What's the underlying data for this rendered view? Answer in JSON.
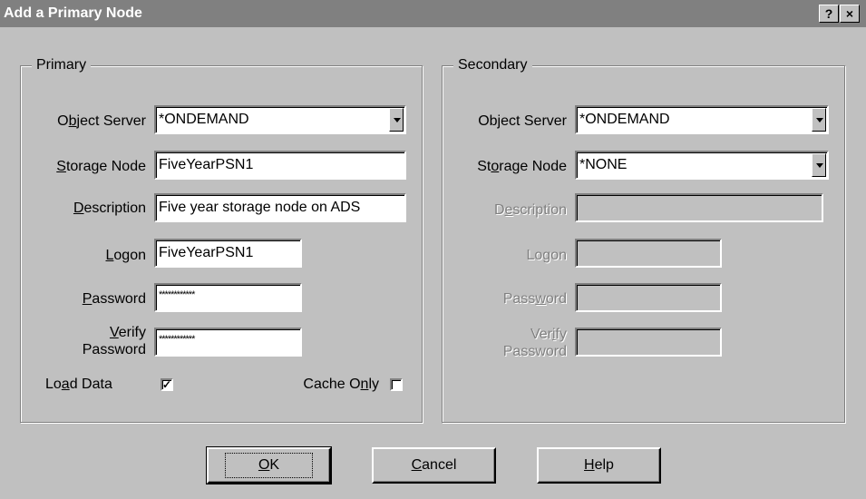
{
  "window": {
    "title": "Add a Primary Node",
    "help_btn": "?",
    "close_btn": "×"
  },
  "primary": {
    "legend": "Primary",
    "object_server": {
      "label_pre": "O",
      "label_ul": "b",
      "label_post": "ject Server",
      "value": "*ONDEMAND"
    },
    "storage_node": {
      "label_pre": "",
      "label_ul": "S",
      "label_post": "torage Node",
      "value": "FiveYearPSN1"
    },
    "description": {
      "label_pre": "",
      "label_ul": "D",
      "label_post": "escription",
      "value": "Five year storage node on ADS"
    },
    "logon": {
      "label_pre": "",
      "label_ul": "L",
      "label_post": "ogon",
      "value": "FiveYearPSN1"
    },
    "password": {
      "label_pre": "",
      "label_ul": "P",
      "label_post": "assword",
      "value": "************"
    },
    "verify_password": {
      "label_pre": "",
      "label_ul": "V",
      "label_post": "erify",
      "label_line2": "Password",
      "value": "************"
    },
    "load_data": {
      "label_pre": "Lo",
      "label_ul": "a",
      "label_post": "d Data",
      "checked": true,
      "mark": "✓"
    },
    "cache_only": {
      "label_pre": "Cache O",
      "label_ul": "n",
      "label_post": "ly",
      "checked": false
    }
  },
  "secondary": {
    "legend": "Secondary",
    "object_server": {
      "label": "Object Server",
      "value": "*ONDEMAND"
    },
    "storage_node": {
      "label_pre": "St",
      "label_ul": "o",
      "label_post": "rage Node",
      "value": "*NONE"
    },
    "description": {
      "label_pre": "D",
      "label_ul": "e",
      "label_post": "scription",
      "value": ""
    },
    "logon": {
      "label_pre": "Lo",
      "label_ul": "g",
      "label_post": "on",
      "value": ""
    },
    "password": {
      "label_pre": "Pass",
      "label_ul": "w",
      "label_post": "ord",
      "value": ""
    },
    "verify_password": {
      "label_pre": "Ver",
      "label_ul": "i",
      "label_post": "fy",
      "label_line2": "Password",
      "value": ""
    }
  },
  "buttons": {
    "ok": {
      "label_ul": "O",
      "label_post": "K"
    },
    "cancel": {
      "label_ul": "C",
      "label_post": "ancel"
    },
    "help": {
      "label_ul": "H",
      "label_post": "elp"
    }
  }
}
